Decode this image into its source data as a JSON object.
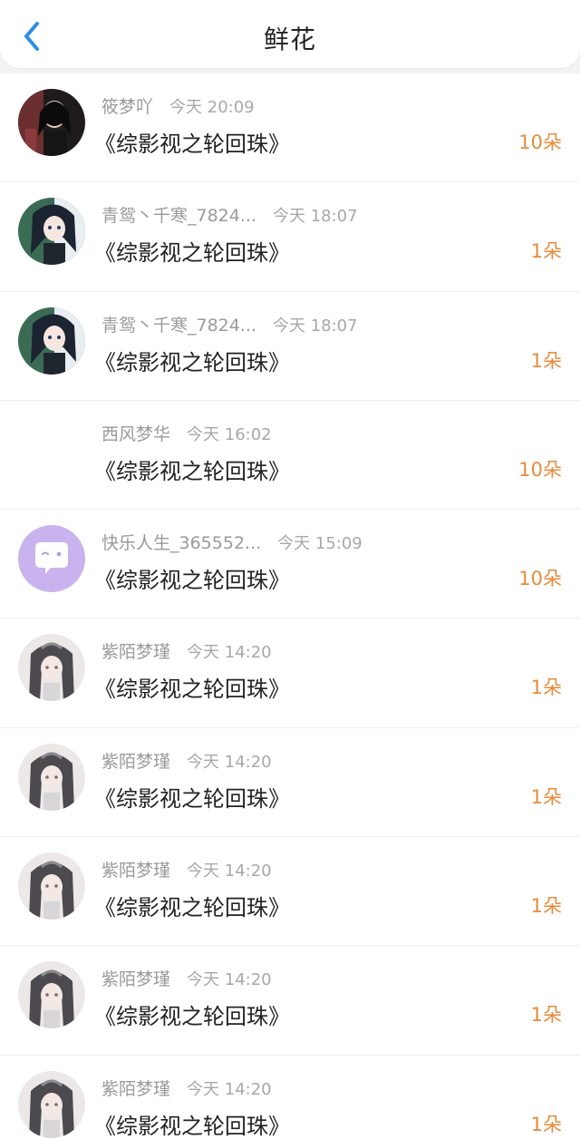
{
  "header": {
    "title": "鲜花",
    "back_icon": "chevron-left-icon",
    "accent_color": "#2a8de4"
  },
  "gifts": [
    {
      "user": "筱梦吖",
      "time": "今天 20:09",
      "book": "《综影视之轮回珠》",
      "count": "10朵",
      "avatar": "avatar-dark-girl"
    },
    {
      "user": "青鸳丶千寒_7824...",
      "time": "今天 18:07",
      "book": "《综影视之轮回珠》",
      "count": "1朵",
      "avatar": "avatar-anime-girl"
    },
    {
      "user": "青鸳丶千寒_7824...",
      "time": "今天 18:07",
      "book": "《综影视之轮回珠》",
      "count": "1朵",
      "avatar": "avatar-anime-girl"
    },
    {
      "user": "西风梦华",
      "time": "今天 16:02",
      "book": "《综影视之轮回珠》",
      "count": "10朵",
      "avatar": "avatar-blank"
    },
    {
      "user": "快乐人生_365552...",
      "time": "今天 15:09",
      "book": "《综影视之轮回珠》",
      "count": "10朵",
      "avatar": "avatar-chat-bubble"
    },
    {
      "user": "紫陌梦瑾",
      "time": "今天 14:20",
      "book": "《综影视之轮回珠》",
      "count": "1朵",
      "avatar": "avatar-ancient-girl"
    },
    {
      "user": "紫陌梦瑾",
      "time": "今天 14:20",
      "book": "《综影视之轮回珠》",
      "count": "1朵",
      "avatar": "avatar-ancient-girl"
    },
    {
      "user": "紫陌梦瑾",
      "time": "今天 14:20",
      "book": "《综影视之轮回珠》",
      "count": "1朵",
      "avatar": "avatar-ancient-girl"
    },
    {
      "user": "紫陌梦瑾",
      "time": "今天 14:20",
      "book": "《综影视之轮回珠》",
      "count": "1朵",
      "avatar": "avatar-ancient-girl"
    },
    {
      "user": "紫陌梦瑾",
      "time": "今天 14:20",
      "book": "《综影视之轮回珠》",
      "count": "1朵",
      "avatar": "avatar-ancient-girl"
    }
  ]
}
